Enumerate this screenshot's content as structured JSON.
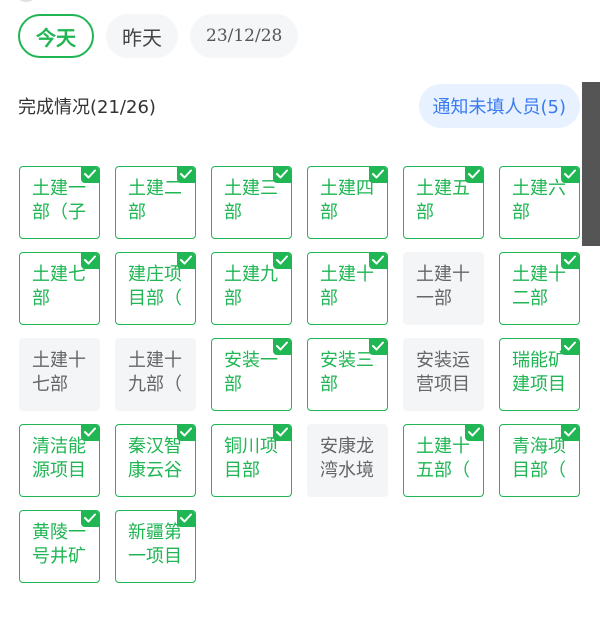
{
  "dates": [
    {
      "label": "今天",
      "active": true
    },
    {
      "label": "昨天",
      "active": false
    },
    {
      "label": "23/12/28",
      "active": false
    }
  ],
  "status": {
    "title": "完成情况(21/26)",
    "notify": "通知未填人员(5)"
  },
  "departments": [
    {
      "label": "土建一部（子",
      "done": true
    },
    {
      "label": "土建二部",
      "done": true
    },
    {
      "label": "土建三部",
      "done": true
    },
    {
      "label": "土建四部",
      "done": true
    },
    {
      "label": "土建五部",
      "done": true
    },
    {
      "label": "土建六部",
      "done": true
    },
    {
      "label": "土建七部",
      "done": true
    },
    {
      "label": "建庄项目部（",
      "done": true
    },
    {
      "label": "土建九部",
      "done": true
    },
    {
      "label": "土建十部",
      "done": true
    },
    {
      "label": "土建十一部",
      "done": false
    },
    {
      "label": "土建十二部",
      "done": true
    },
    {
      "label": "土建十七部",
      "done": false
    },
    {
      "label": "土建十九部（",
      "done": false
    },
    {
      "label": "安装一部",
      "done": true
    },
    {
      "label": "安装三部",
      "done": true
    },
    {
      "label": "安装运营项目",
      "done": false
    },
    {
      "label": "瑞能矿建项目",
      "done": true
    },
    {
      "label": "清洁能源项目",
      "done": true
    },
    {
      "label": "秦汉智康云谷",
      "done": true
    },
    {
      "label": "铜川项目部",
      "done": true
    },
    {
      "label": "安康龙湾水境",
      "done": false
    },
    {
      "label": "土建十五部（",
      "done": true
    },
    {
      "label": "青海项目部（",
      "done": true
    },
    {
      "label": "黄陵一号井矿",
      "done": true
    },
    {
      "label": "新疆第一项目",
      "done": true
    }
  ],
  "colors": {
    "accent": "#1fb653",
    "notify_text": "#3a7cf0",
    "notify_bg": "#e8f1ff",
    "pending_bg": "#f4f5f7"
  }
}
